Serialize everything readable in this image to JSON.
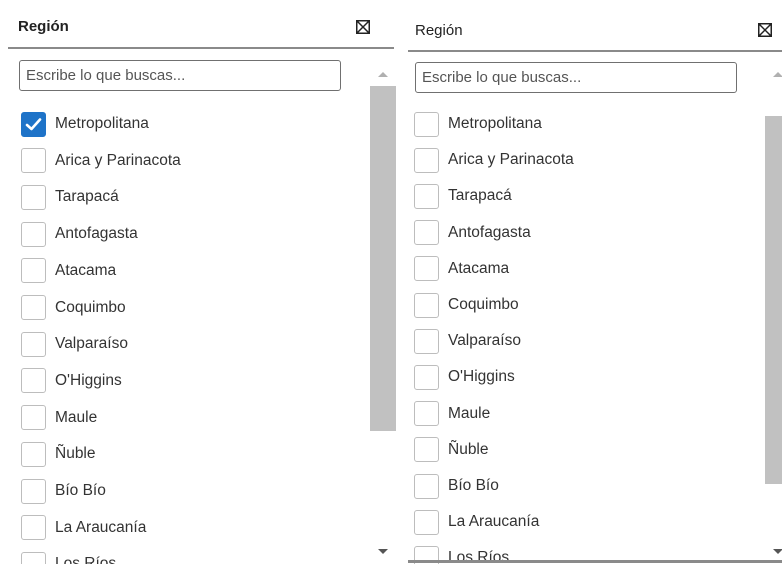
{
  "left_panel": {
    "title": "Región",
    "search": {
      "placeholder": "Escribe lo que buscas...",
      "value": ""
    },
    "options": [
      {
        "label": "Metropolitana",
        "checked": true
      },
      {
        "label": "Arica y Parinacota",
        "checked": false
      },
      {
        "label": "Tarapacá",
        "checked": false
      },
      {
        "label": "Antofagasta",
        "checked": false
      },
      {
        "label": "Atacama",
        "checked": false
      },
      {
        "label": "Coquimbo",
        "checked": false
      },
      {
        "label": "Valparaíso",
        "checked": false
      },
      {
        "label": "O'Higgins",
        "checked": false
      },
      {
        "label": "Maule",
        "checked": false
      },
      {
        "label": "Ñuble",
        "checked": false
      },
      {
        "label": "Bío Bío",
        "checked": false
      },
      {
        "label": "La Araucanía",
        "checked": false
      },
      {
        "label": "Los Ríos",
        "checked": false
      }
    ]
  },
  "right_panel": {
    "title": "Región",
    "search": {
      "placeholder": "Escribe lo que buscas...",
      "value": ""
    },
    "options": [
      {
        "label": "Metropolitana",
        "checked": false
      },
      {
        "label": "Arica y Parinacota",
        "checked": false
      },
      {
        "label": "Tarapacá",
        "checked": false
      },
      {
        "label": "Antofagasta",
        "checked": false
      },
      {
        "label": "Atacama",
        "checked": false
      },
      {
        "label": "Coquimbo",
        "checked": false
      },
      {
        "label": "Valparaíso",
        "checked": false
      },
      {
        "label": "O'Higgins",
        "checked": false
      },
      {
        "label": "Maule",
        "checked": false
      },
      {
        "label": "Ñuble",
        "checked": false
      },
      {
        "label": "Bío Bío",
        "checked": false
      },
      {
        "label": "La Araucanía",
        "checked": false
      },
      {
        "label": "Los Ríos",
        "checked": false
      }
    ]
  },
  "icons": {
    "close": "close-box-icon",
    "checked": "checkmark-icon",
    "scroll_up": "scroll-up-arrow-icon",
    "scroll_down": "scroll-down-arrow-icon"
  },
  "colors": {
    "checked_fill": "#1e73c8",
    "checkbox_border": "#bdbdbd",
    "scroll_thumb": "#c1c1c1",
    "rule": "#8a8a8a"
  }
}
